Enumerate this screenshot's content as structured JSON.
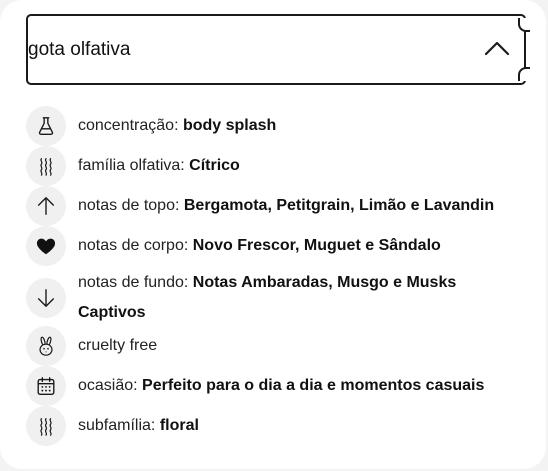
{
  "accordion": {
    "title": "gota olfativa",
    "toggle_icon": "chevron-up-icon"
  },
  "attributes": [
    {
      "icon": "flask-icon",
      "label": "concentração",
      "separator": ": ",
      "value": "body splash"
    },
    {
      "icon": "aroma-waves-icon",
      "label": "família olfativa",
      "separator": ": ",
      "value": "Cítrico"
    },
    {
      "icon": "arrow-up-icon",
      "label": "notas de topo",
      "separator": ": ",
      "value": "Bergamota, Petitgrain, Limão e Lavandin"
    },
    {
      "icon": "heart-icon",
      "label": "notas de corpo",
      "separator": ": ",
      "value": "Novo Frescor, Muguet e Sândalo"
    },
    {
      "icon": "arrow-down-icon",
      "label": "notas de fundo",
      "separator": ": ",
      "value": "Notas Ambaradas, Musgo e Musks Captivos"
    },
    {
      "icon": "bunny-icon",
      "label": "cruelty free",
      "separator": "",
      "value": ""
    },
    {
      "icon": "calendar-icon",
      "label": "ocasião",
      "separator": ": ",
      "value": "Perfeito para o dia a dia e momentos casuais"
    },
    {
      "icon": "aroma-waves-icon",
      "label": "subfamília",
      "separator": ": ",
      "value": "floral"
    }
  ]
}
